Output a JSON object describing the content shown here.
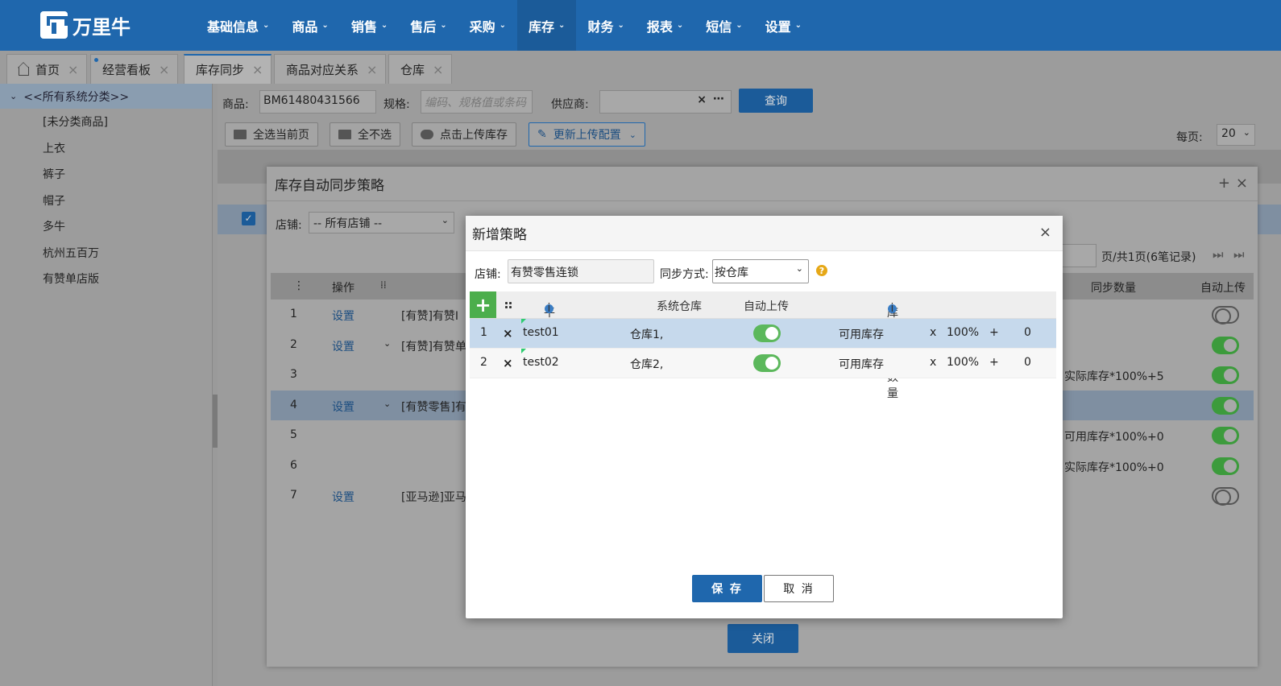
{
  "app": {
    "logo_text": "万里牛"
  },
  "nav": [
    "基础信息",
    "商品",
    "销售",
    "售后",
    "采购",
    "库存",
    "财务",
    "报表",
    "短信",
    "设置"
  ],
  "tabs": [
    "首页",
    "经营看板",
    "库存同步",
    "商品对应关系",
    "仓库"
  ],
  "sidebar": {
    "root": "<<所有系统分类>>",
    "items": [
      "[未分类商品]",
      "上衣",
      "裤子",
      "帽子",
      "多牛",
      "杭州五百万",
      "有赞单店版"
    ]
  },
  "filter": {
    "product_label": "商品:",
    "product_value": "BM61480431566",
    "spec_label": "规格:",
    "spec_placeholder": "编码、规格值或条码",
    "supplier_label": "供应商:",
    "query_button": "查询"
  },
  "toolbar": {
    "select_page": "全选当前页",
    "deselect_all": "全不选",
    "upload_stock": "点击上传库存",
    "update_config": "更新上传配置",
    "per_page_label": "每页:",
    "per_page_value": "20"
  },
  "outer_dialog": {
    "title": "库存自动同步策略",
    "shop_label": "店铺:",
    "shop_value": "-- 所有店铺 --",
    "pagination": "页/共1页(6笔记录)",
    "columns": [
      "操作",
      "同步数量",
      "自动上传"
    ],
    "rows": [
      {
        "no": "1",
        "op": "设置",
        "name": "[有赞]有赞I",
        "qty": "",
        "auto": false
      },
      {
        "no": "2",
        "op": "设置",
        "name": "[有赞]有赞单",
        "qty": "",
        "auto": true
      },
      {
        "no": "3",
        "op": "",
        "name": "",
        "qty": "实际库存*100%+5",
        "auto": true
      },
      {
        "no": "4",
        "op": "设置",
        "name": "[有赞零售]有",
        "qty": "",
        "auto": true
      },
      {
        "no": "5",
        "op": "",
        "name": "",
        "qty": "可用库存*100%+0",
        "auto": true
      },
      {
        "no": "6",
        "op": "",
        "name": "",
        "qty": "实际库存*100%+0",
        "auto": true
      },
      {
        "no": "7",
        "op": "设置",
        "name": "[亚马逊]亚马",
        "qty": "",
        "auto": false
      }
    ],
    "close_button": "关闭"
  },
  "dialog": {
    "title": "新增策略",
    "shop_label": "店铺:",
    "shop_value": "有赞零售连锁",
    "sync_label": "同步方式:",
    "sync_value": "按仓库",
    "columns": {
      "platform_wh": "平台仓库",
      "system_wh": "系统仓库",
      "auto_upload": "自动上传",
      "sync_qty": "库存同步数量"
    },
    "rows": [
      {
        "no": "1",
        "platform": "test01",
        "system": "仓库1,",
        "auto": true,
        "base": "可用库存",
        "mul": "x",
        "pct": "100%",
        "plus": "+",
        "add": "0"
      },
      {
        "no": "2",
        "platform": "test02",
        "system": "仓库2,",
        "auto": true,
        "base": "可用库存",
        "mul": "x",
        "pct": "100%",
        "plus": "+",
        "add": "0"
      }
    ],
    "save_button": "保 存",
    "cancel_button": "取 消"
  }
}
